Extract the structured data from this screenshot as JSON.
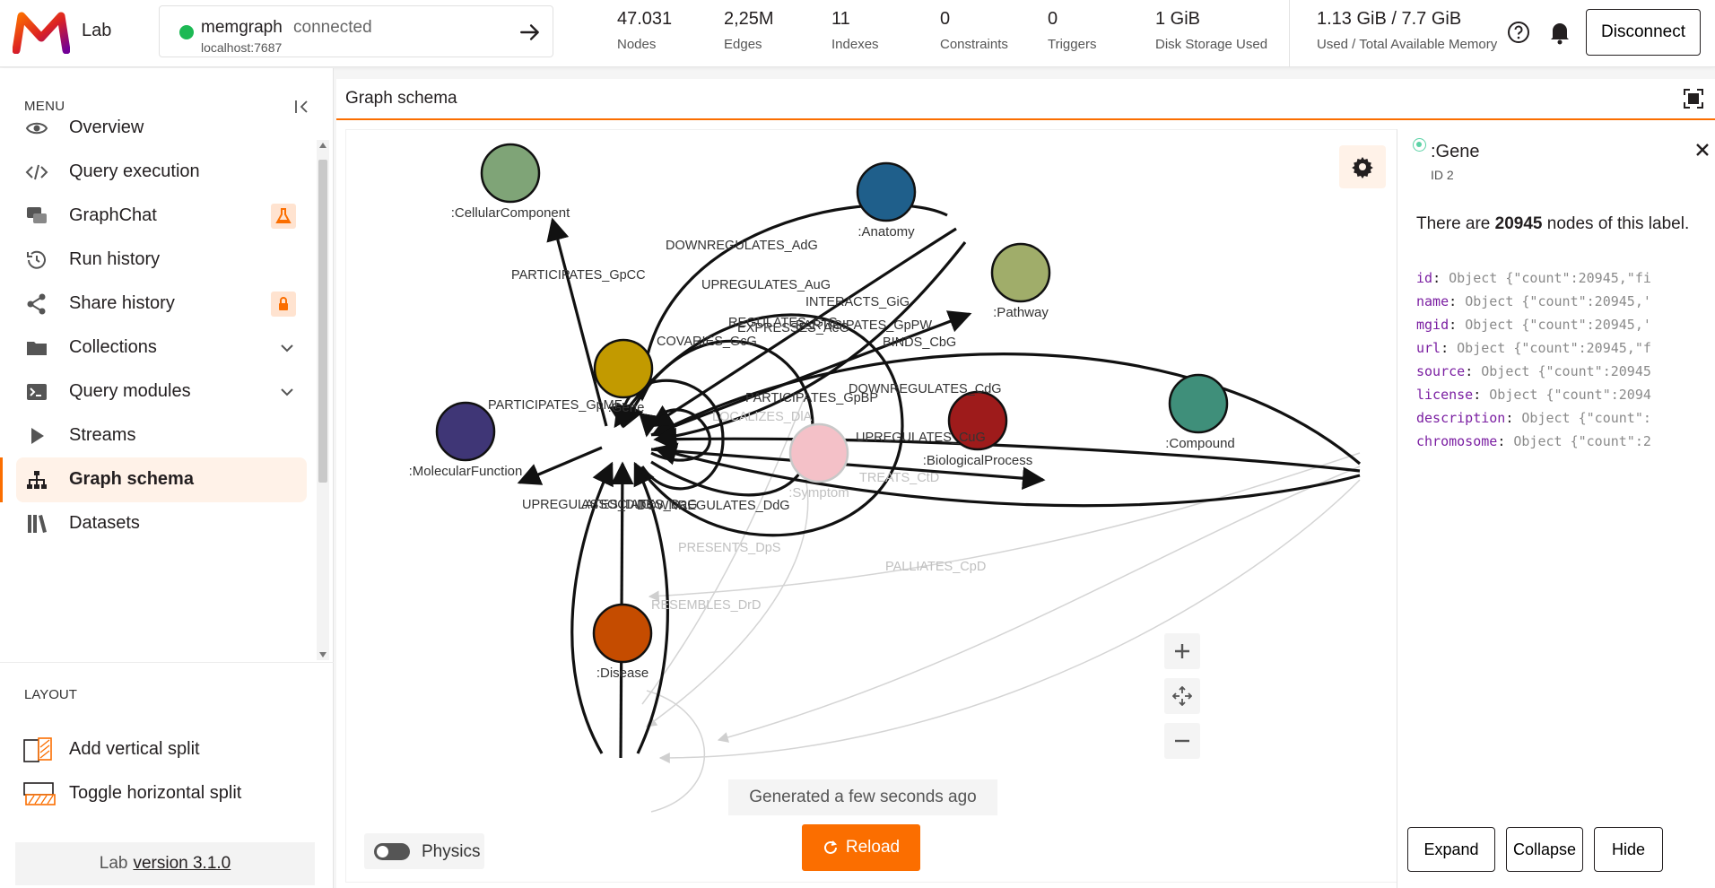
{
  "app": {
    "name": "Lab"
  },
  "connection": {
    "name": "memgraph",
    "status": "connected",
    "host": "localhost:7687"
  },
  "stats": [
    {
      "value": "47.031",
      "label": "Nodes"
    },
    {
      "value": "2,25M",
      "label": "Edges"
    },
    {
      "value": "11",
      "label": "Indexes"
    },
    {
      "value": "0",
      "label": "Constraints"
    },
    {
      "value": "0",
      "label": "Triggers"
    },
    {
      "value": "1 GiB",
      "label": "Disk Storage Used"
    },
    {
      "value": "1.13 GiB / 7.7 GiB",
      "label": "Used / Total Available Memory"
    }
  ],
  "header": {
    "disconnect_label": "Disconnect"
  },
  "sidebar": {
    "menu_header": "MENU",
    "items": [
      {
        "label": "Overview",
        "icon": "eye-icon"
      },
      {
        "label": "Query execution",
        "icon": "code-icon"
      },
      {
        "label": "GraphChat",
        "icon": "chat-icon",
        "badge": "flask-icon"
      },
      {
        "label": "Run history",
        "icon": "history-icon"
      },
      {
        "label": "Share history",
        "icon": "share-icon",
        "badge": "lock-icon"
      },
      {
        "label": "Collections",
        "icon": "folder-icon",
        "chevron": true
      },
      {
        "label": "Query modules",
        "icon": "terminal-icon",
        "chevron": true
      },
      {
        "label": "Streams",
        "icon": "play-icon"
      },
      {
        "label": "Graph schema",
        "icon": "hierarchy-icon",
        "active": true
      },
      {
        "label": "Datasets",
        "icon": "books-icon"
      }
    ],
    "layout_header": "LAYOUT",
    "layout_items": [
      {
        "label": "Add vertical split",
        "icon": "vertical-split-icon"
      },
      {
        "label": "Toggle horizontal split",
        "icon": "horizontal-split-icon"
      }
    ],
    "version_prefix": "Lab",
    "version_link": "version 3.1.0"
  },
  "main": {
    "title": "Graph schema",
    "generated": "Generated a few seconds ago",
    "reload_label": "Reload",
    "physics_label": "Physics"
  },
  "graph": {
    "nodes": [
      {
        "label": ":CellularComponent",
        "color": "#7fa477"
      },
      {
        "label": ":Anatomy",
        "color": "#1f5f8b"
      },
      {
        "label": ":Pathway",
        "color": "#a0ad6a"
      },
      {
        "label": ":Gene",
        "color": "#c29a00"
      },
      {
        "label": ":MolecularFunction",
        "color": "#3f3676"
      },
      {
        "label": ":BiologicalProcess",
        "color": "#9e1b1b"
      },
      {
        "label": ":Symptom",
        "color": "#f4c1c8"
      },
      {
        "label": ":Compound",
        "color": "#3f8f7a"
      },
      {
        "label": ":Disease",
        "color": "#c54c00"
      }
    ],
    "edge_labels": [
      "PARTICIPATES_GpCC",
      "DOWNREGULATES_AdG",
      "UPREGULATES_AuG",
      "INTERACTS_GiG",
      "REGULATES_GrG",
      "EXPRESSES_AeG",
      "PARTICIPATES_GpPW",
      "COVARIES_GcG",
      "BINDS_CbG",
      "DOWNREGULATES_CdG",
      "PARTICIPATES_GpMF",
      "PARTICIPATES_GpBP",
      "LOCALIZES_DlA",
      "UPREGULATES_CuG",
      "TREATS_CtD",
      "UPREGULATES_DuG",
      "ASSOCIATES_DaG",
      "DOWNREGULATES_DdG",
      "PRESENTS_DpS",
      "PALLIATES_CpD",
      "RESEMBLES_DrD"
    ]
  },
  "details": {
    "title": ":Gene",
    "id": "ID 2",
    "desc_prefix": "There are",
    "count": "20945",
    "desc_suffix": "nodes of this label.",
    "properties": [
      {
        "key": "id",
        "value": "Object {\"count\":20945,\"fi"
      },
      {
        "key": "name",
        "value": "Object {\"count\":20945,'"
      },
      {
        "key": "mgid",
        "value": "Object {\"count\":20945,'"
      },
      {
        "key": "url",
        "value": "Object {\"count\":20945,\"f"
      },
      {
        "key": "source",
        "value": "Object {\"count\":20945"
      },
      {
        "key": "license",
        "value": "Object {\"count\":2094"
      },
      {
        "key": "description",
        "value": "Object {\"count\":"
      },
      {
        "key": "chromosome",
        "value": "Object {\"count\":2"
      }
    ],
    "expand_label": "Expand",
    "collapse_label": "Collapse",
    "hide_label": "Hide"
  }
}
